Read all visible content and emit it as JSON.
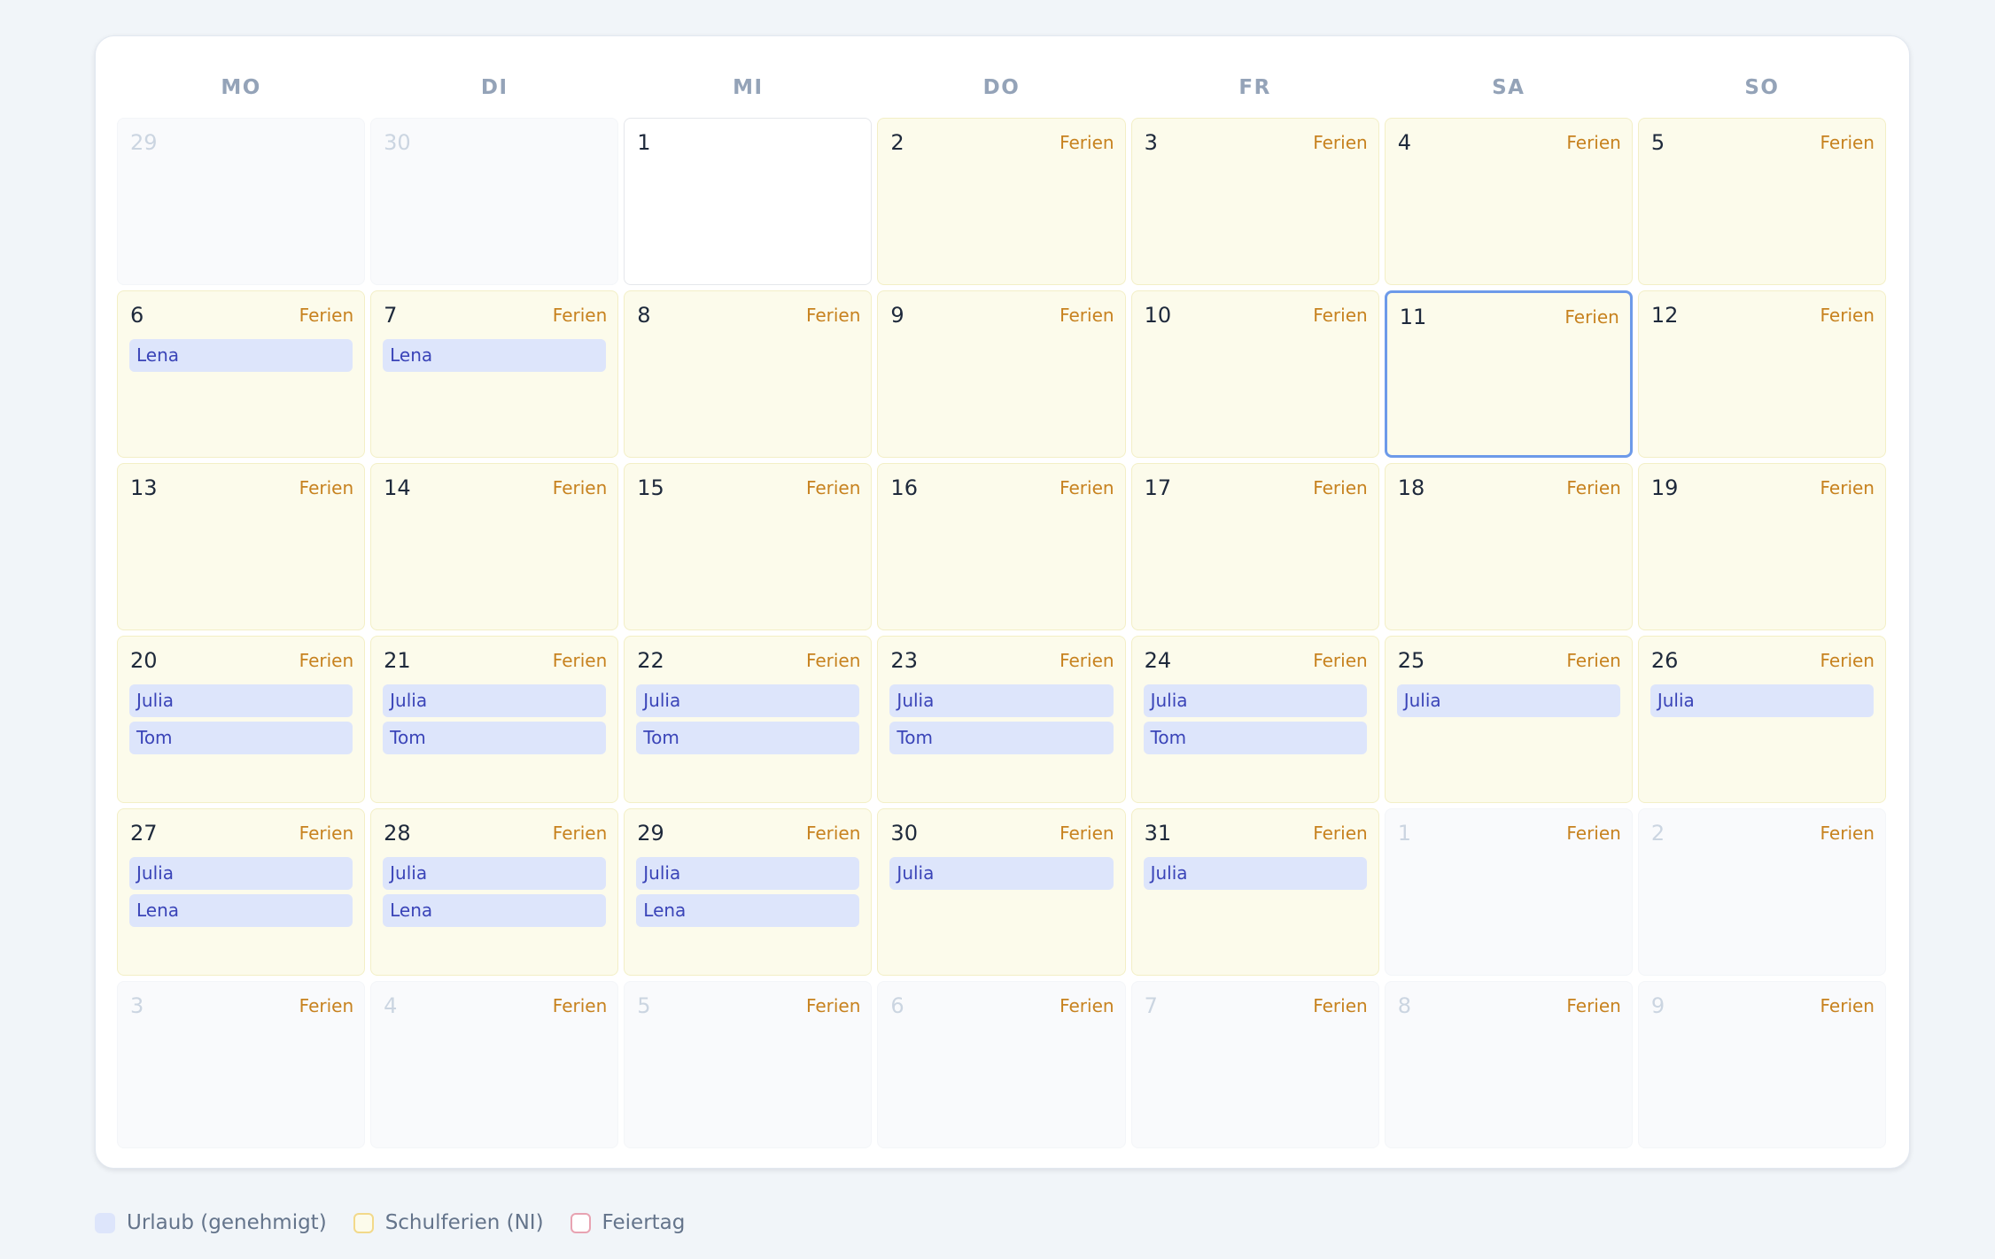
{
  "weekdays": [
    "MO",
    "DI",
    "MI",
    "DO",
    "FR",
    "SA",
    "SO"
  ],
  "days": [
    {
      "d": "29",
      "other": true,
      "ferien": false,
      "events": []
    },
    {
      "d": "30",
      "other": true,
      "ferien": false,
      "events": []
    },
    {
      "d": "1",
      "other": false,
      "ferien": false,
      "events": []
    },
    {
      "d": "2",
      "other": false,
      "ferien": true,
      "events": []
    },
    {
      "d": "3",
      "other": false,
      "ferien": true,
      "events": []
    },
    {
      "d": "4",
      "other": false,
      "ferien": true,
      "events": []
    },
    {
      "d": "5",
      "other": false,
      "ferien": true,
      "events": []
    },
    {
      "d": "6",
      "other": false,
      "ferien": true,
      "events": [
        "Lena"
      ]
    },
    {
      "d": "7",
      "other": false,
      "ferien": true,
      "events": [
        "Lena"
      ]
    },
    {
      "d": "8",
      "other": false,
      "ferien": true,
      "events": []
    },
    {
      "d": "9",
      "other": false,
      "ferien": true,
      "events": []
    },
    {
      "d": "10",
      "other": false,
      "ferien": true,
      "events": []
    },
    {
      "d": "11",
      "other": false,
      "ferien": true,
      "today": true,
      "events": []
    },
    {
      "d": "12",
      "other": false,
      "ferien": true,
      "events": []
    },
    {
      "d": "13",
      "other": false,
      "ferien": true,
      "events": []
    },
    {
      "d": "14",
      "other": false,
      "ferien": true,
      "events": []
    },
    {
      "d": "15",
      "other": false,
      "ferien": true,
      "events": []
    },
    {
      "d": "16",
      "other": false,
      "ferien": true,
      "events": []
    },
    {
      "d": "17",
      "other": false,
      "ferien": true,
      "events": []
    },
    {
      "d": "18",
      "other": false,
      "ferien": true,
      "events": []
    },
    {
      "d": "19",
      "other": false,
      "ferien": true,
      "events": []
    },
    {
      "d": "20",
      "other": false,
      "ferien": true,
      "events": [
        "Julia",
        "Tom"
      ]
    },
    {
      "d": "21",
      "other": false,
      "ferien": true,
      "events": [
        "Julia",
        "Tom"
      ]
    },
    {
      "d": "22",
      "other": false,
      "ferien": true,
      "events": [
        "Julia",
        "Tom"
      ]
    },
    {
      "d": "23",
      "other": false,
      "ferien": true,
      "events": [
        "Julia",
        "Tom"
      ]
    },
    {
      "d": "24",
      "other": false,
      "ferien": true,
      "events": [
        "Julia",
        "Tom"
      ]
    },
    {
      "d": "25",
      "other": false,
      "ferien": true,
      "events": [
        "Julia"
      ]
    },
    {
      "d": "26",
      "other": false,
      "ferien": true,
      "events": [
        "Julia"
      ]
    },
    {
      "d": "27",
      "other": false,
      "ferien": true,
      "events": [
        "Julia",
        "Lena"
      ]
    },
    {
      "d": "28",
      "other": false,
      "ferien": true,
      "events": [
        "Julia",
        "Lena"
      ]
    },
    {
      "d": "29",
      "other": false,
      "ferien": true,
      "events": [
        "Julia",
        "Lena"
      ]
    },
    {
      "d": "30",
      "other": false,
      "ferien": true,
      "events": [
        "Julia"
      ]
    },
    {
      "d": "31",
      "other": false,
      "ferien": true,
      "events": [
        "Julia"
      ]
    },
    {
      "d": "1",
      "other": true,
      "ferien": true,
      "events": []
    },
    {
      "d": "2",
      "other": true,
      "ferien": true,
      "events": []
    },
    {
      "d": "3",
      "other": true,
      "ferien": true,
      "events": []
    },
    {
      "d": "4",
      "other": true,
      "ferien": true,
      "events": []
    },
    {
      "d": "5",
      "other": true,
      "ferien": true,
      "events": []
    },
    {
      "d": "6",
      "other": true,
      "ferien": true,
      "events": []
    },
    {
      "d": "7",
      "other": true,
      "ferien": true,
      "events": []
    },
    {
      "d": "8",
      "other": true,
      "ferien": true,
      "events": []
    },
    {
      "d": "9",
      "other": true,
      "ferien": true,
      "events": []
    }
  ],
  "tag_label": "Ferien",
  "legend": {
    "vacation": "Urlaub (genehmigt)",
    "school": "Schulferien (NI)",
    "holiday": "Feiertag"
  },
  "colors": {
    "vacation_bg": "#dde5fb",
    "vacation_text": "#3a44b8",
    "school_bg": "#fcfbeb",
    "ferien_text": "#c7821f",
    "holiday_border": "#e8a3b2",
    "today_border": "#6d9ae9"
  }
}
